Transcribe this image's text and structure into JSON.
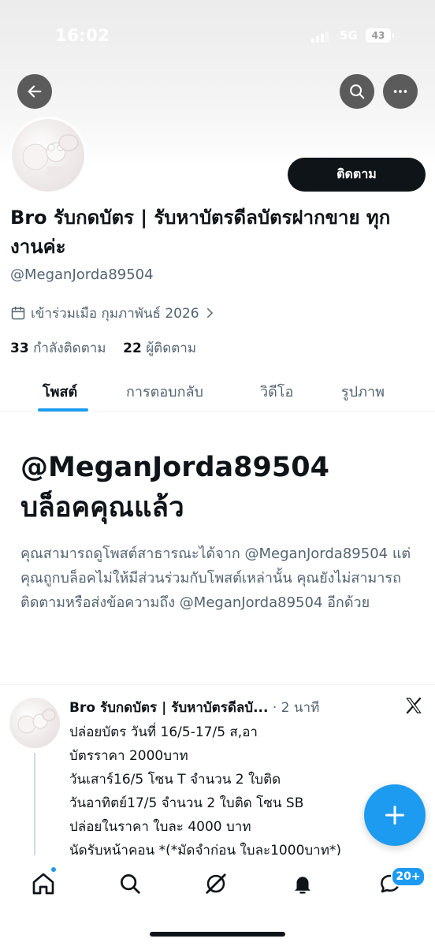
{
  "status_bar": {
    "time": "16:02",
    "network": "5G",
    "battery": "43"
  },
  "header": {
    "back_icon": "arrow-left-icon",
    "search_icon": "search-icon",
    "more_icon": "more-horizontal-icon"
  },
  "profile": {
    "follow_label": "ติดตาม",
    "display_name": "Bro รับกดบัตร | รับหาบัตรดีลบัตรฝากขาย ทุกงานค่ะ",
    "handle": "@MeganJorda89504",
    "joined": "เข้าร่วมเมือ กุมภาพันธ์ 2026",
    "following_count": "33",
    "following_label": "กำลังติดตาม",
    "followers_count": "22",
    "followers_label": "ผู้ติดตาม"
  },
  "tabs": [
    {
      "label": "โพสต์",
      "active": true
    },
    {
      "label": "การตอบกลับ",
      "active": false
    },
    {
      "label": "วิดีโอ",
      "active": false
    },
    {
      "label": "รูปภาพ",
      "active": false
    }
  ],
  "blocked": {
    "title_handle": "@MeganJorda89504",
    "title_text": "บล็อคคุณแล้ว",
    "description": "คุณสามารถดูโพสต์สาธารณะได้จาก @MeganJorda89504 แต่คุณถูกบล็อคไม่ให้มีส่วนร่วมกับโพสต์เหล่านั้น คุณยังไม่สามารถติดตามหรือส่งข้อความถึง @MeganJorda89504 อีกด้วย"
  },
  "post": {
    "author": "Bro รับกดบัตร | รับหาบัตรดีลบั...",
    "time": "· 2 นาที",
    "lines": [
      "ปล่อยบัตร  วันที่ 16/5-17/5 ส,อา",
      "บัตรราคา 2000บาท",
      "วันเสาร์16/5 โซน T จำนวน 2 ใบติด",
      "วันอาทิตย์17/5 จำนวน 2 ใบติด โซน SB",
      "ปล่อยในราคา ใบละ 4000 บาท",
      "นัดรับหน้าคอน *(*มัดจำก่อน ใบละ1000บาท*)"
    ]
  },
  "fab": {
    "icon": "plus-icon"
  },
  "bottom_nav": {
    "items": [
      "home-icon",
      "search-icon",
      "grok-icon",
      "notifications-icon",
      "messages-icon"
    ],
    "messages_badge": "20+"
  },
  "colors": {
    "accent": "#1d9bf0",
    "text": "#0f1419",
    "secondary": "#536471"
  }
}
